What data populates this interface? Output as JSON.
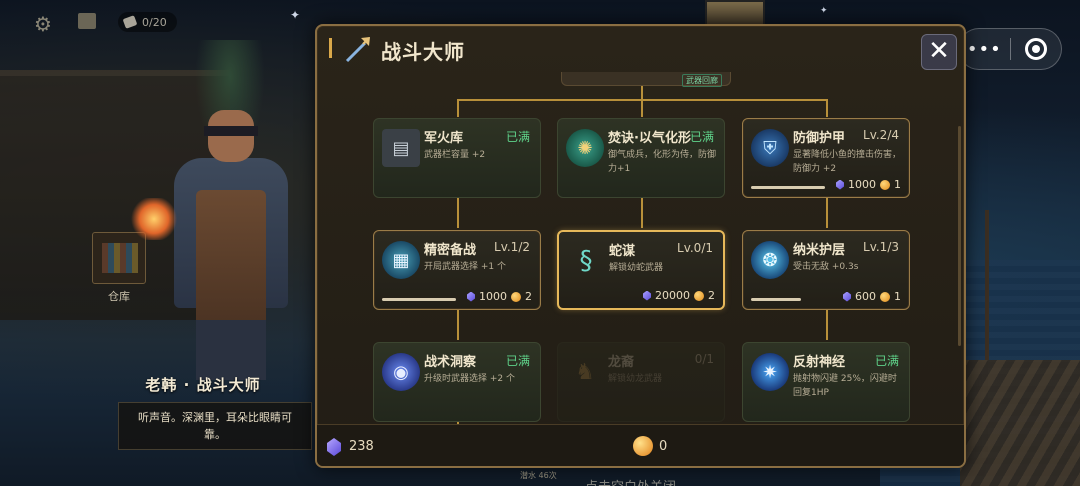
{
  "hud": {
    "counter": "0/20"
  },
  "npc": {
    "name": "老韩 · 战斗大师",
    "quote": "听声音。深渊里，耳朵比眼睛可靠。",
    "warehouse_label": "仓库"
  },
  "dialog": {
    "title": "战斗大师",
    "close": "✕",
    "top_tag": "武器回廊"
  },
  "nodes": [
    {
      "name": "军火库",
      "level": "已满",
      "desc": "武器栏容量 +2",
      "icon": "armory-icon"
    },
    {
      "name": "焚诀·以气化形",
      "level": "已满",
      "desc": "御气成兵，化形为侍，防御力+1",
      "icon": "jade-ring-icon"
    },
    {
      "name": "防御护甲",
      "level": "Lv.2/4",
      "desc": "显著降低小鱼的撞击伤害，防御力 +2",
      "icon": "shield-icon",
      "gem_cost": "1000",
      "coin_cost": "1",
      "progress": 0.5
    },
    {
      "name": "精密备战",
      "level": "Lv.1/2",
      "desc": "开局武器选择 +1 个",
      "icon": "cards-icon",
      "gem_cost": "1000",
      "coin_cost": "2",
      "progress": 0.5
    },
    {
      "name": "蛇谋",
      "level": "Lv.0/1",
      "desc": "解锁幼蛇武器",
      "icon": "snake-icon",
      "gem_cost": "20000",
      "coin_cost": "2"
    },
    {
      "name": "纳米护层",
      "level": "Lv.1/3",
      "desc": "受击无敌 +0.3s",
      "icon": "nano-icon",
      "gem_cost": "600",
      "coin_cost": "1",
      "progress": 0.33
    },
    {
      "name": "战术洞察",
      "level": "已满",
      "desc": "升级时武器选择 +2 个",
      "icon": "eye-icon"
    },
    {
      "name": "龙裔",
      "level": "0/1",
      "desc": "解锁幼龙武器",
      "icon": "dragon-icon"
    },
    {
      "name": "反射神经",
      "level": "已满",
      "desc": "抛射物闪避 25%，闪避时回复1HP",
      "icon": "nerve-icon"
    }
  ],
  "footer": {
    "gems": "238",
    "coins": "0"
  },
  "bottom": {
    "water_label": "潜水 46次",
    "hint": "点击空白处关闭"
  },
  "capsule": {
    "more": "•••"
  }
}
